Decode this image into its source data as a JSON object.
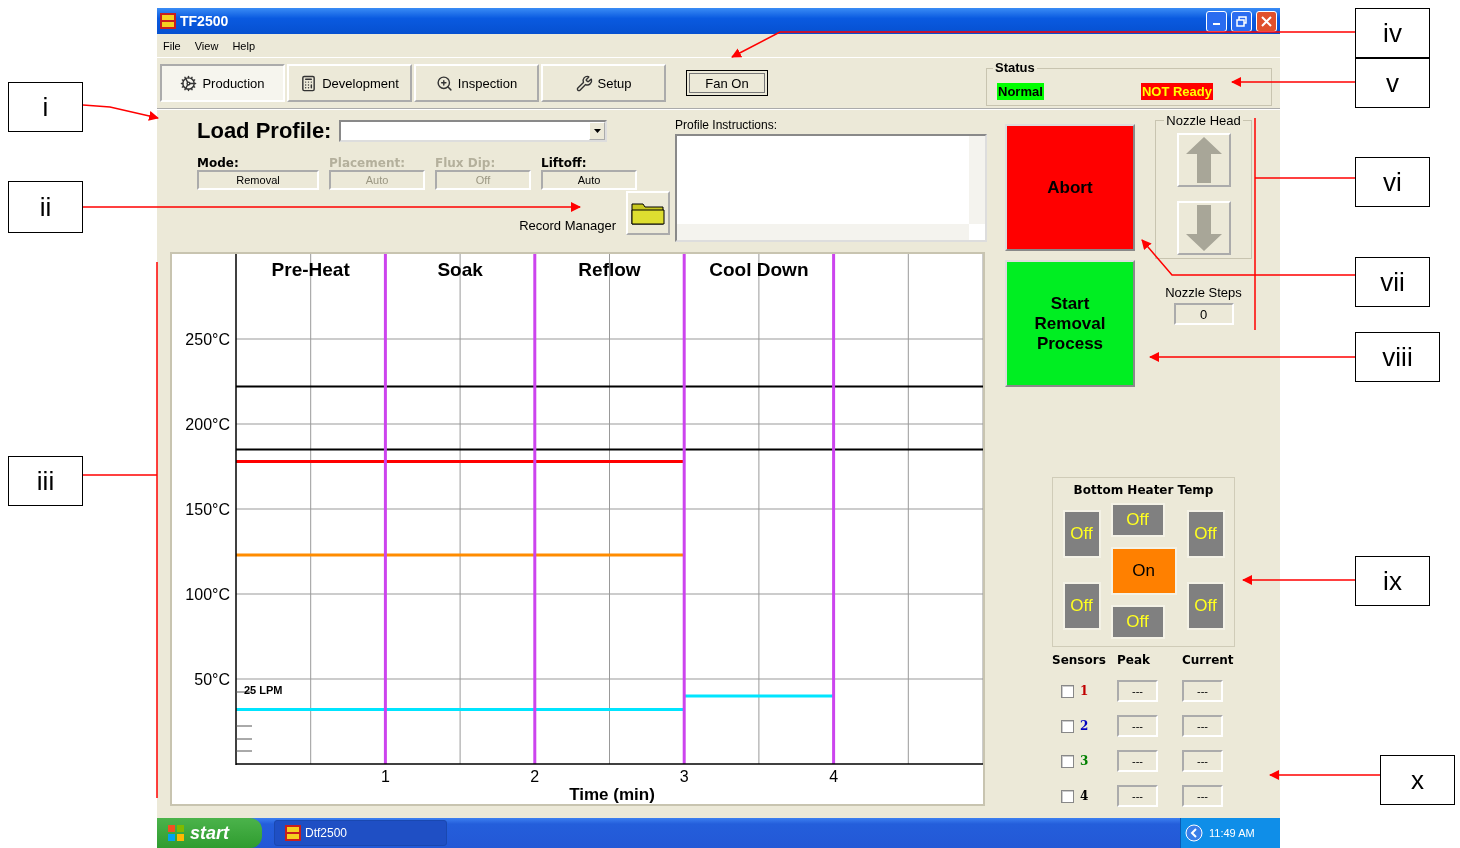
{
  "window": {
    "title": "TF2500"
  },
  "menu": [
    "File",
    "View",
    "Help"
  ],
  "tabs": [
    {
      "label": "Production",
      "selected": true
    },
    {
      "label": "Development",
      "selected": false
    },
    {
      "label": "Inspection",
      "selected": false
    },
    {
      "label": "Setup",
      "selected": false
    }
  ],
  "fan_button": "Fan On",
  "status": {
    "title": "Status",
    "items": [
      {
        "text": "Normal",
        "kind": "ok",
        "color": "#00ff00"
      },
      {
        "text": "NOT Ready",
        "kind": "alert",
        "color": "#ff0000"
      }
    ]
  },
  "load_profile": {
    "label": "Load Profile:"
  },
  "fields": [
    {
      "label": "Mode:",
      "value": "Removal",
      "disabled": false
    },
    {
      "label": "Placement:",
      "value": "Auto",
      "disabled": true
    },
    {
      "label": "Flux Dip:",
      "value": "Off",
      "disabled": true
    },
    {
      "label": "Liftoff:",
      "value": "Auto",
      "disabled": false
    }
  ],
  "record_manager": "Record Manager",
  "profile_instructions": {
    "label": "Profile Instructions:"
  },
  "chart": {
    "phases": [
      "Pre-Heat",
      "Soak",
      "Reflow",
      "Cool Down"
    ],
    "chart_data": {
      "type": "line",
      "xlabel": "Time (min)",
      "x": [
        0,
        3,
        4,
        5
      ],
      "xlim": [
        0,
        5
      ],
      "ylim": [
        0,
        300
      ],
      "xticks": [
        1,
        2,
        3,
        4
      ],
      "yticks": [
        {
          "value": 50,
          "label": "50°C"
        },
        {
          "value": 100,
          "label": "100°C"
        },
        {
          "value": 150,
          "label": "150°C"
        },
        {
          "value": 200,
          "label": "200°C"
        },
        {
          "value": 250,
          "label": "250°C"
        }
      ],
      "series": [
        {
          "color": "#000000",
          "values": [
            222,
            222,
            222,
            222
          ]
        },
        {
          "color": "#000000",
          "values": [
            185,
            185,
            185,
            185
          ]
        },
        {
          "color": "#ff0000",
          "values": [
            178,
            178,
            null,
            null
          ]
        },
        {
          "color": "#ff8c00",
          "values": [
            123,
            123,
            null,
            null
          ]
        },
        {
          "color": "#00e5ff",
          "values": [
            32,
            32,
            null,
            null
          ]
        },
        {
          "color": "#00e5ff",
          "values": [
            null,
            40,
            40,
            null
          ]
        }
      ],
      "grid": true,
      "annotations": [
        "25 LPM"
      ]
    }
  },
  "abort_button": "Abort",
  "start_button": "Start Removal Process",
  "nozzle_head": {
    "title": "Nozzle Head"
  },
  "nozzle_steps": {
    "label": "Nozzle Steps",
    "value": "0"
  },
  "bottom_heater": {
    "title": "Bottom Heater Temp",
    "zones": [
      {
        "label": "Off",
        "on": false
      },
      {
        "label": "Off",
        "on": false
      },
      {
        "label": "On",
        "on": true
      },
      {
        "label": "Off",
        "on": false
      },
      {
        "label": "Off",
        "on": false
      },
      {
        "label": "Off",
        "on": false
      },
      {
        "label": "Off",
        "on": false
      }
    ]
  },
  "sensors": {
    "columns": [
      "Sensors",
      "Peak",
      "Current"
    ],
    "rows": [
      {
        "label": "1",
        "color": "#c00000",
        "checked": false,
        "peak": "---",
        "current": "---"
      },
      {
        "label": "2",
        "color": "#0000c0",
        "checked": false,
        "peak": "---",
        "current": "---"
      },
      {
        "label": "3",
        "color": "#008000",
        "checked": false,
        "peak": "---",
        "current": "---"
      },
      {
        "label": "4",
        "color": "#000000",
        "checked": false,
        "peak": "---",
        "current": "---"
      }
    ]
  },
  "taskbar": {
    "start": "start",
    "tasks": [
      "Dtf2500"
    ],
    "clock": "11:49 AM"
  },
  "callouts": [
    "i",
    "ii",
    "iii",
    "iv",
    "v",
    "vi",
    "vii",
    "viii",
    "ix",
    "x"
  ]
}
